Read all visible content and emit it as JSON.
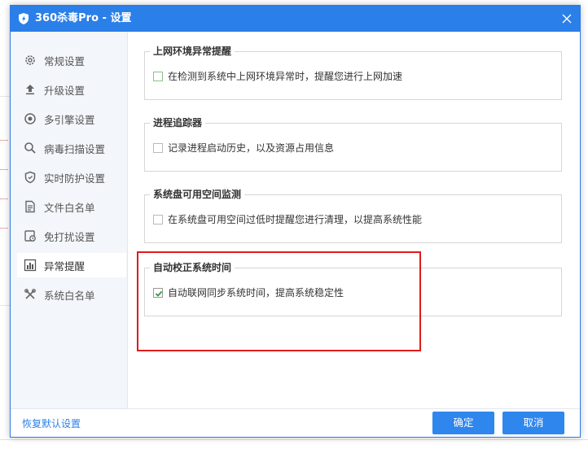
{
  "window": {
    "title": "360杀毒Pro - 设置"
  },
  "sidebar": {
    "items": [
      {
        "label": "常规设置",
        "icon": "gear-icon"
      },
      {
        "label": "升级设置",
        "icon": "upload-icon"
      },
      {
        "label": "多引擎设置",
        "icon": "engine-icon"
      },
      {
        "label": "病毒扫描设置",
        "icon": "search-icon"
      },
      {
        "label": "实时防护设置",
        "icon": "shield-icon"
      },
      {
        "label": "文件白名单",
        "icon": "file-icon"
      },
      {
        "label": "免打扰设置",
        "icon": "do-not-disturb-icon"
      },
      {
        "label": "异常提醒",
        "icon": "bar-chart-icon",
        "active": true
      },
      {
        "label": "系统白名单",
        "icon": "tools-icon"
      }
    ]
  },
  "groups": [
    {
      "legend": "上网环境异常提醒",
      "option": "在检测到系统中上网环境异常时，提醒您进行上网加速",
      "checked": false
    },
    {
      "legend": "进程追踪器",
      "option": "记录进程启动历史，以及资源占用信息",
      "checked": false
    },
    {
      "legend": "系统盘可用空间监测",
      "option": "在系统盘可用空间过低时提醒您进行清理，以提高系统性能",
      "checked": false
    },
    {
      "legend": "自动校正系统时间",
      "option": "自动联网同步系统时间，提高系统稳定性",
      "checked": true
    }
  ],
  "footer": {
    "restore_label": "恢复默认设置",
    "ok_label": "确定",
    "cancel_label": "取消"
  },
  "colors": {
    "accent": "#2b7fe8",
    "highlight": "#e01b1b"
  }
}
